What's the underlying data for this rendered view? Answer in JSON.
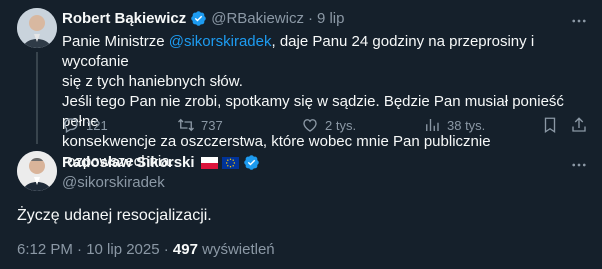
{
  "tweet1": {
    "author_name": "Robert Bąkiewicz",
    "handle": "@RBakiewicz",
    "separator": "·",
    "time": "9 lip",
    "text_pre": "Panie Ministrze ",
    "mention": "@sikorskiradek",
    "text_post_line1": ", daje Panu 24 godziny na przeprosiny i wycofanie",
    "text_line2": "się z tych haniebnych słów.",
    "text_line3": "Jeśli tego Pan nie zrobi, spotkamy się w sądzie. Będzie Pan musiał ponieść pełne",
    "text_line4": "konsekwencje za oszczerstwa, które wobec mnie Pan publicznie rozpowszechnia.",
    "actions": {
      "replies": "121",
      "reposts": "737",
      "likes": "2 tys.",
      "views": "38 tys."
    }
  },
  "tweet2": {
    "author_name": "Radosław Sikorski",
    "handle": "@sikorskiradek",
    "text": "Życzę udanej resocjalizacji.",
    "timestamp": "6:12 PM · 10 lip 2025 · ",
    "views_count": "497",
    "views_label": " wyświetleń"
  },
  "colors": {
    "background": "#15202b",
    "accent": "#1d9bf0",
    "muted": "#8b98a5",
    "text": "#f7f9f9"
  },
  "icons": [
    "more-icon",
    "reply-icon",
    "repost-icon",
    "like-icon",
    "views-icon",
    "bookmark-icon",
    "share-icon",
    "verified-icon",
    "poland-flag-icon",
    "eu-flag-icon"
  ]
}
